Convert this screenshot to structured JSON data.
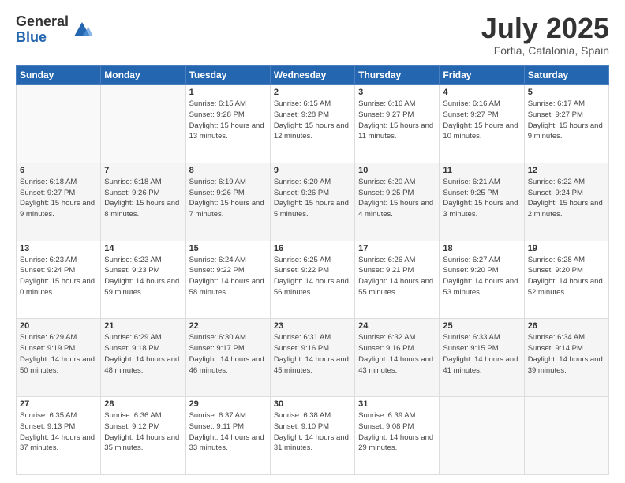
{
  "logo": {
    "general": "General",
    "blue": "Blue"
  },
  "title": {
    "month": "July 2025",
    "location": "Fortia, Catalonia, Spain"
  },
  "days_of_week": [
    "Sunday",
    "Monday",
    "Tuesday",
    "Wednesday",
    "Thursday",
    "Friday",
    "Saturday"
  ],
  "weeks": [
    [
      {
        "day": "",
        "info": ""
      },
      {
        "day": "",
        "info": ""
      },
      {
        "day": "1",
        "info": "Sunrise: 6:15 AM\nSunset: 9:28 PM\nDaylight: 15 hours and 13 minutes."
      },
      {
        "day": "2",
        "info": "Sunrise: 6:15 AM\nSunset: 9:28 PM\nDaylight: 15 hours and 12 minutes."
      },
      {
        "day": "3",
        "info": "Sunrise: 6:16 AM\nSunset: 9:27 PM\nDaylight: 15 hours and 11 minutes."
      },
      {
        "day": "4",
        "info": "Sunrise: 6:16 AM\nSunset: 9:27 PM\nDaylight: 15 hours and 10 minutes."
      },
      {
        "day": "5",
        "info": "Sunrise: 6:17 AM\nSunset: 9:27 PM\nDaylight: 15 hours and 9 minutes."
      }
    ],
    [
      {
        "day": "6",
        "info": "Sunrise: 6:18 AM\nSunset: 9:27 PM\nDaylight: 15 hours and 9 minutes."
      },
      {
        "day": "7",
        "info": "Sunrise: 6:18 AM\nSunset: 9:26 PM\nDaylight: 15 hours and 8 minutes."
      },
      {
        "day": "8",
        "info": "Sunrise: 6:19 AM\nSunset: 9:26 PM\nDaylight: 15 hours and 7 minutes."
      },
      {
        "day": "9",
        "info": "Sunrise: 6:20 AM\nSunset: 9:26 PM\nDaylight: 15 hours and 5 minutes."
      },
      {
        "day": "10",
        "info": "Sunrise: 6:20 AM\nSunset: 9:25 PM\nDaylight: 15 hours and 4 minutes."
      },
      {
        "day": "11",
        "info": "Sunrise: 6:21 AM\nSunset: 9:25 PM\nDaylight: 15 hours and 3 minutes."
      },
      {
        "day": "12",
        "info": "Sunrise: 6:22 AM\nSunset: 9:24 PM\nDaylight: 15 hours and 2 minutes."
      }
    ],
    [
      {
        "day": "13",
        "info": "Sunrise: 6:23 AM\nSunset: 9:24 PM\nDaylight: 15 hours and 0 minutes."
      },
      {
        "day": "14",
        "info": "Sunrise: 6:23 AM\nSunset: 9:23 PM\nDaylight: 14 hours and 59 minutes."
      },
      {
        "day": "15",
        "info": "Sunrise: 6:24 AM\nSunset: 9:22 PM\nDaylight: 14 hours and 58 minutes."
      },
      {
        "day": "16",
        "info": "Sunrise: 6:25 AM\nSunset: 9:22 PM\nDaylight: 14 hours and 56 minutes."
      },
      {
        "day": "17",
        "info": "Sunrise: 6:26 AM\nSunset: 9:21 PM\nDaylight: 14 hours and 55 minutes."
      },
      {
        "day": "18",
        "info": "Sunrise: 6:27 AM\nSunset: 9:20 PM\nDaylight: 14 hours and 53 minutes."
      },
      {
        "day": "19",
        "info": "Sunrise: 6:28 AM\nSunset: 9:20 PM\nDaylight: 14 hours and 52 minutes."
      }
    ],
    [
      {
        "day": "20",
        "info": "Sunrise: 6:29 AM\nSunset: 9:19 PM\nDaylight: 14 hours and 50 minutes."
      },
      {
        "day": "21",
        "info": "Sunrise: 6:29 AM\nSunset: 9:18 PM\nDaylight: 14 hours and 48 minutes."
      },
      {
        "day": "22",
        "info": "Sunrise: 6:30 AM\nSunset: 9:17 PM\nDaylight: 14 hours and 46 minutes."
      },
      {
        "day": "23",
        "info": "Sunrise: 6:31 AM\nSunset: 9:16 PM\nDaylight: 14 hours and 45 minutes."
      },
      {
        "day": "24",
        "info": "Sunrise: 6:32 AM\nSunset: 9:16 PM\nDaylight: 14 hours and 43 minutes."
      },
      {
        "day": "25",
        "info": "Sunrise: 6:33 AM\nSunset: 9:15 PM\nDaylight: 14 hours and 41 minutes."
      },
      {
        "day": "26",
        "info": "Sunrise: 6:34 AM\nSunset: 9:14 PM\nDaylight: 14 hours and 39 minutes."
      }
    ],
    [
      {
        "day": "27",
        "info": "Sunrise: 6:35 AM\nSunset: 9:13 PM\nDaylight: 14 hours and 37 minutes."
      },
      {
        "day": "28",
        "info": "Sunrise: 6:36 AM\nSunset: 9:12 PM\nDaylight: 14 hours and 35 minutes."
      },
      {
        "day": "29",
        "info": "Sunrise: 6:37 AM\nSunset: 9:11 PM\nDaylight: 14 hours and 33 minutes."
      },
      {
        "day": "30",
        "info": "Sunrise: 6:38 AM\nSunset: 9:10 PM\nDaylight: 14 hours and 31 minutes."
      },
      {
        "day": "31",
        "info": "Sunrise: 6:39 AM\nSunset: 9:08 PM\nDaylight: 14 hours and 29 minutes."
      },
      {
        "day": "",
        "info": ""
      },
      {
        "day": "",
        "info": ""
      }
    ]
  ]
}
